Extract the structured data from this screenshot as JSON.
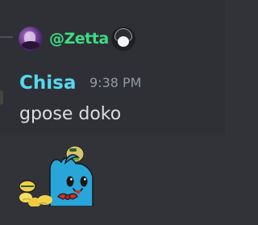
{
  "reply": {
    "author": "@Zetta",
    "avatar_icon": "user-avatar-icon",
    "mention_icon": "mentioned-user-avatar-icon"
  },
  "message": {
    "author": "Chisa",
    "author_color": "#56d8ee",
    "timestamp": "9:38 PM",
    "content": "gpose doko",
    "sticker_icon": "blue-cat-money-sticker-icon"
  },
  "colors": {
    "background": "#313338",
    "reply_name": "#3ddc84",
    "timestamp": "#949ba4",
    "text": "#dbdee1"
  }
}
